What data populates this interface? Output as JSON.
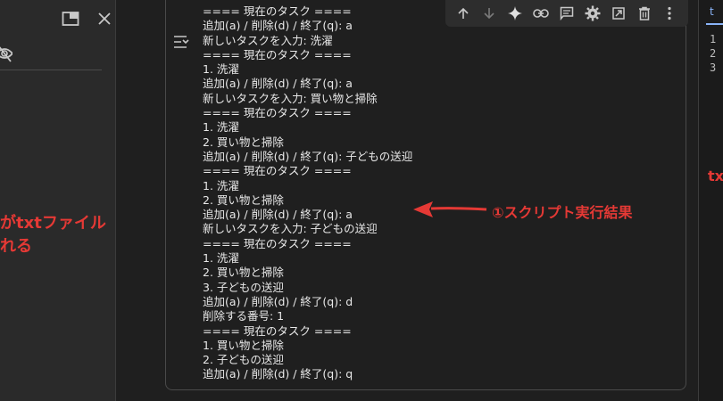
{
  "output": {
    "lines": [
      "==== 現在のタスク ====",
      "追加(a) / 削除(d) / 終了(q): a",
      "新しいタスクを入力: 洗濯",
      "==== 現在のタスク ====",
      "1. 洗濯",
      "追加(a) / 削除(d) / 終了(q): a",
      "新しいタスクを入力: 買い物と掃除",
      "==== 現在のタスク ====",
      "1. 洗濯",
      "2. 買い物と掃除",
      "追加(a) / 削除(d) / 終了(q): 子どもの送迎",
      "==== 現在のタスク ====",
      "1. 洗濯",
      "2. 買い物と掃除",
      "追加(a) / 削除(d) / 終了(q): a",
      "新しいタスクを入力: 子どもの送迎",
      "==== 現在のタスク ====",
      "1. 洗濯",
      "2. 買い物と掃除",
      "3. 子どもの送迎",
      "追加(a) / 削除(d) / 終了(q): d",
      "削除する番号: 1",
      "==== 現在のタスク ====",
      "1. 買い物と掃除",
      "2. 子どもの送迎",
      "追加(a) / 削除(d) / 終了(q): q"
    ]
  },
  "annotations": {
    "left_line1": "がtxtファイル",
    "left_line2": "れる",
    "center_label": "①スクリプト実行結果",
    "right_label": "tx"
  },
  "right_panel": {
    "tab_label": "t",
    "line_numbers": [
      "1",
      "2",
      "3"
    ]
  },
  "icons": {
    "left_panel": [
      "open-in-new-panel-icon",
      "close-icon",
      "visibility-off-icon"
    ],
    "output": "output-settings-icon",
    "toolbar": [
      "arrow-up-icon",
      "arrow-down-icon",
      "sparkle-icon",
      "link-icon",
      "comment-icon",
      "gear-icon",
      "mirror-cell-icon",
      "trash-icon",
      "more-vert-icon"
    ]
  },
  "colors": {
    "annotation_red": "#e53935",
    "background": "#1f1f1f",
    "accent_blue": "#8ab4f8"
  }
}
